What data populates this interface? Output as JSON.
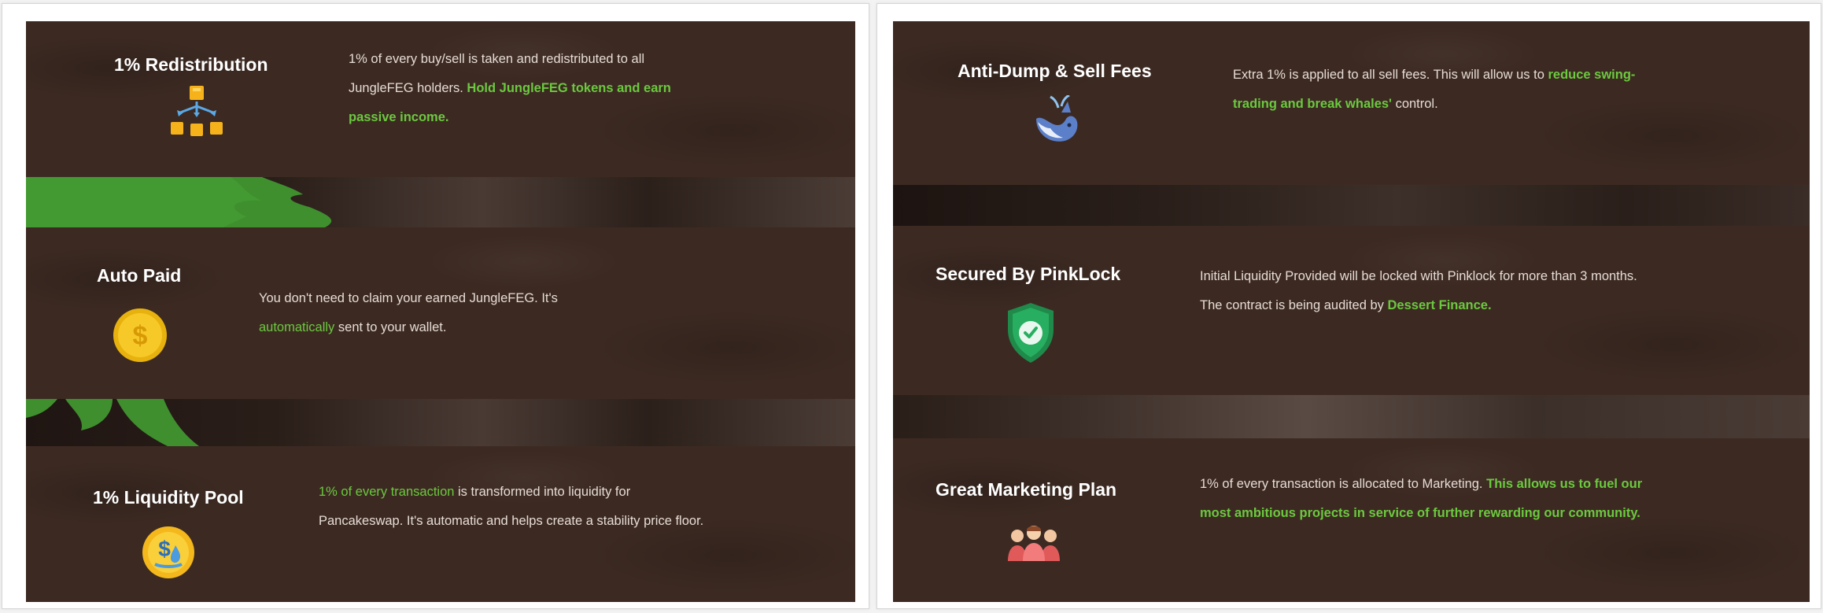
{
  "left_panel": {
    "features": [
      {
        "title": "1% Redistribution",
        "icon": "network-distribution-icon",
        "desc_plain": "1% of every buy/sell is taken and redistributed to all JungleFEG holders.",
        "desc_highlight": "Hold JungleFEG tokens and earn passive income."
      },
      {
        "title": "Auto Paid",
        "icon": "gold-coin-dollar-icon",
        "desc_plain": "You don't need to claim your earned JungleFEG. It's",
        "desc_highlight": "automatically",
        "desc_tail": "sent to your wallet."
      },
      {
        "title": "1% Liquidity Pool",
        "icon": "liquidity-coin-icon",
        "desc_highlight": "1% of every transaction",
        "desc_plain": "is transformed into liquidity for Pancakeswap. It's automatic and helps create a stability price floor."
      }
    ]
  },
  "right_panel": {
    "features": [
      {
        "title": "Anti-Dump & Sell Fees",
        "icon": "whale-icon",
        "desc_plain": "Extra 1% is applied to all sell fees. This will allow us to",
        "desc_highlight": "reduce swing-trading and break whales'",
        "desc_tail": "control."
      },
      {
        "title": "Secured By PinkLock",
        "icon": "shield-check-icon",
        "desc_plain": "Initial Liquidity Provided will be locked with Pinklock for more than 3 months. The contract is being audited by",
        "desc_highlight": "Dessert Finance."
      },
      {
        "title": "Great Marketing Plan",
        "icon": "people-group-icon",
        "desc_plain": "1% of every transaction is allocated to Marketing.",
        "desc_highlight": "This allows us to fuel our most ambitious projects in service of further rewarding our community."
      }
    ]
  },
  "colors": {
    "background_brown": "#3c2a22",
    "highlight_green": "#6bc93f",
    "leaf_green": "#3f8f2e"
  }
}
